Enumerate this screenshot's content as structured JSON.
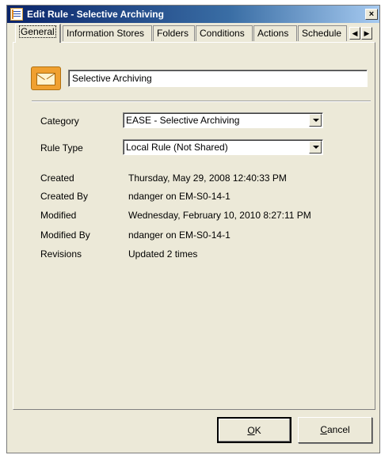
{
  "window": {
    "title": "Edit Rule - Selective Archiving",
    "close_glyph": "×"
  },
  "tabs": [
    {
      "label": "General",
      "active": true
    },
    {
      "label": "Information Stores"
    },
    {
      "label": "Folders"
    },
    {
      "label": "Conditions"
    },
    {
      "label": "Actions"
    },
    {
      "label": "Schedule"
    }
  ],
  "tab_scroll": {
    "left_glyph": "◀",
    "right_glyph": "▶"
  },
  "rule": {
    "icon": "envelope-icon",
    "name_value": "Selective Archiving"
  },
  "fields": {
    "category_label": "Category",
    "category_value": "EASE - Selective Archiving",
    "rule_type_label": "Rule Type",
    "rule_type_value": "Local Rule (Not Shared)"
  },
  "info": [
    {
      "label": "Created",
      "value": "Thursday, May 29, 2008 12:40:33 PM"
    },
    {
      "label": "Created By",
      "value": "ndanger on EM-S0-14-1"
    },
    {
      "label": "Modified",
      "value": "Wednesday, February 10, 2010 8:27:11 PM"
    },
    {
      "label": "Modified By",
      "value": "ndanger on EM-S0-14-1"
    },
    {
      "label": "Revisions",
      "value": "Updated 2 times"
    }
  ],
  "buttons": {
    "ok_underlined": "O",
    "ok_rest": "K",
    "cancel_underlined": "C",
    "cancel_rest": "ancel"
  },
  "colors": {
    "titlebar_start": "#0a246a",
    "dialog_face": "#ece9d8",
    "envelope": "#f0a030"
  }
}
